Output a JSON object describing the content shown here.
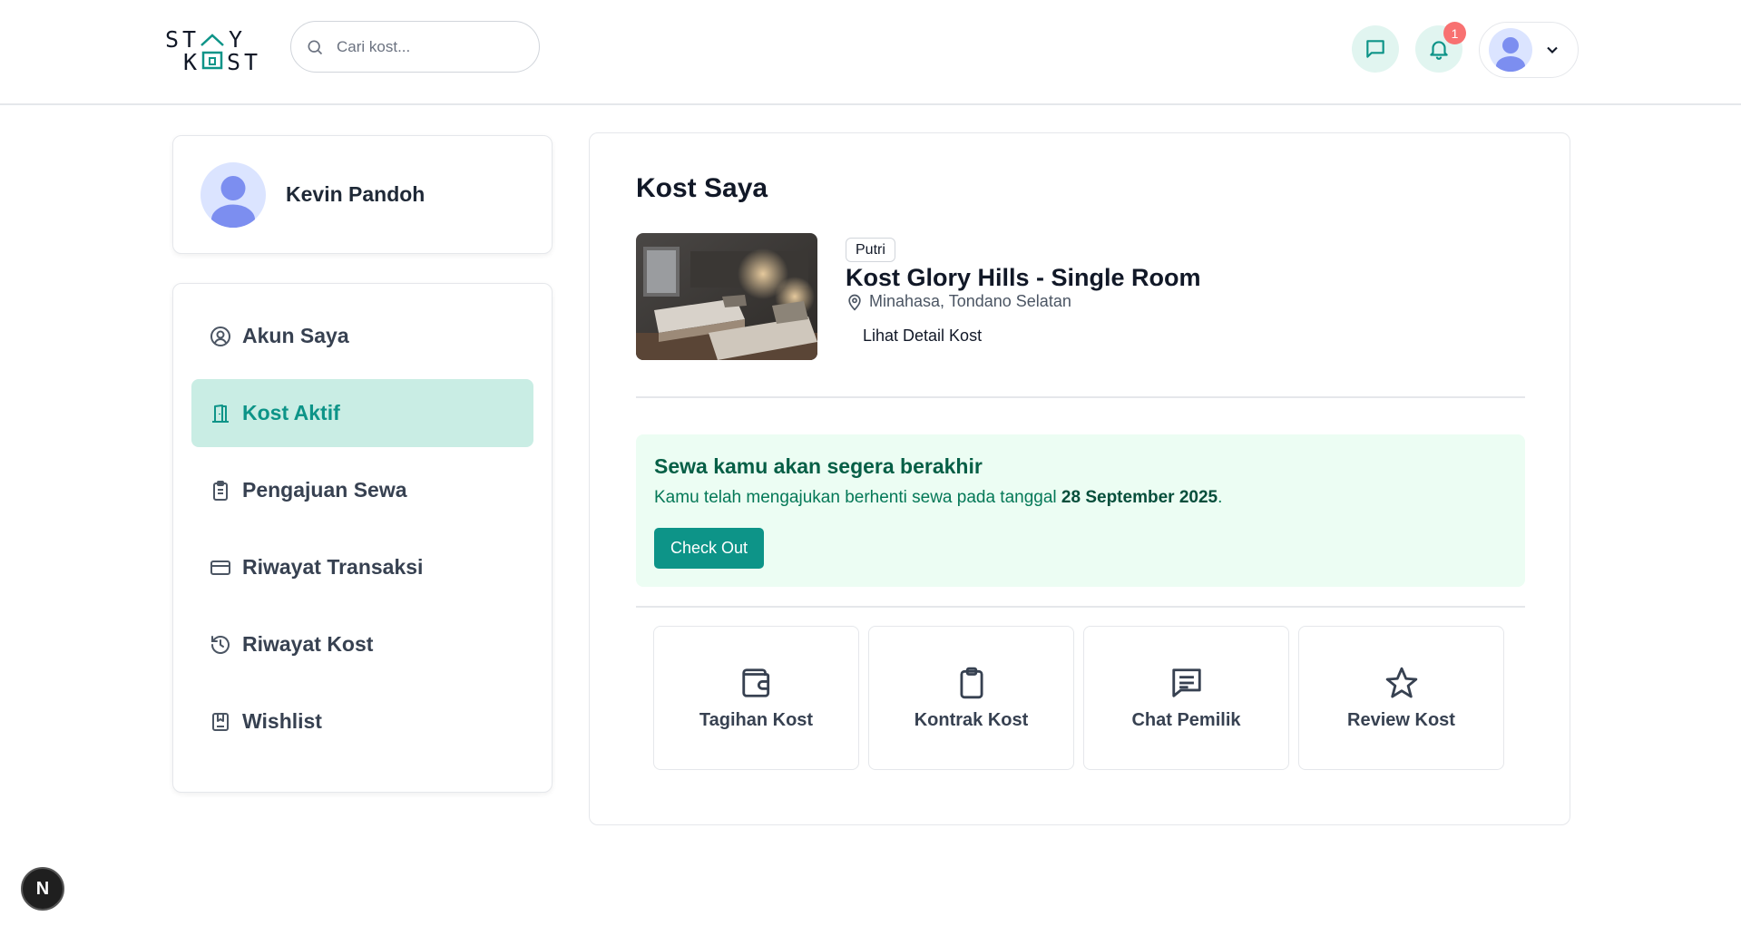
{
  "header": {
    "logo_top": "ST Y",
    "logo_bottom": "K ST",
    "search_placeholder": "Cari kost...",
    "notification_count": "1",
    "accent_color": "#0d9488"
  },
  "profile": {
    "name": "Kevin Pandoh"
  },
  "sidebar": {
    "items": [
      {
        "label": "Akun Saya",
        "icon": "user-circle-icon",
        "active": false
      },
      {
        "label": "Kost Aktif",
        "icon": "door-icon",
        "active": true
      },
      {
        "label": "Pengajuan Sewa",
        "icon": "clipboard-list-icon",
        "active": false
      },
      {
        "label": "Riwayat Transaksi",
        "icon": "credit-card-icon",
        "active": false
      },
      {
        "label": "Riwayat Kost",
        "icon": "history-icon",
        "active": false
      },
      {
        "label": "Wishlist",
        "icon": "bookmark-icon",
        "active": false
      }
    ]
  },
  "main": {
    "title": "Kost Saya",
    "kost": {
      "gender": "Putri",
      "name": "Kost Glory Hills - Single Room",
      "location": "Minahasa, Tondano Selatan",
      "detail_link": "Lihat Detail Kost"
    },
    "alert": {
      "title": "Sewa kamu akan segera berakhir",
      "text_before": "Kamu telah mengajukan berhenti sewa pada tanggal ",
      "date": "28 September 2025",
      "text_after": ".",
      "button": "Check Out"
    },
    "actions": [
      {
        "label": "Tagihan Kost",
        "icon": "wallet-icon"
      },
      {
        "label": "Kontrak Kost",
        "icon": "clipboard-icon"
      },
      {
        "label": "Chat Pemilik",
        "icon": "message-icon"
      },
      {
        "label": "Review Kost",
        "icon": "star-icon"
      }
    ]
  },
  "dev_badge": "N"
}
